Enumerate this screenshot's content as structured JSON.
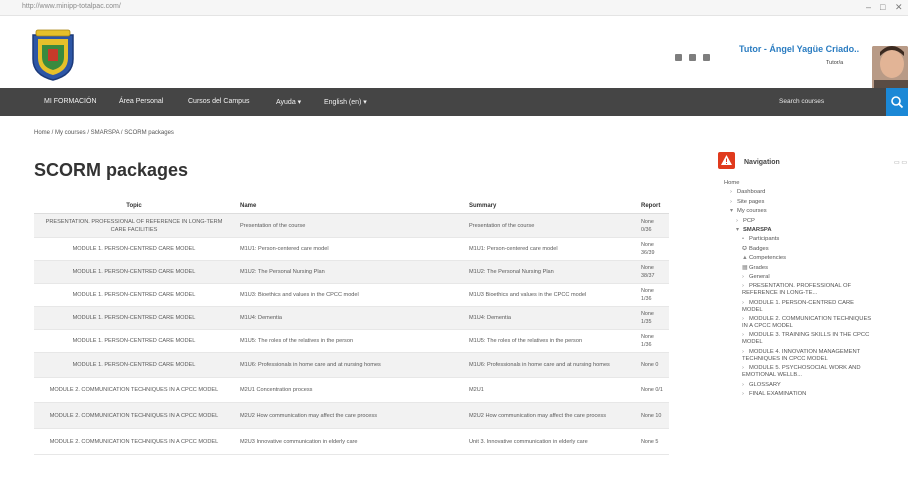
{
  "browser": {
    "url": "http://www.minipp-totalpac.com/",
    "controls": [
      "–",
      "□",
      "✕"
    ]
  },
  "header": {
    "crest_icon": "coat-of-arms-icon",
    "icons": [
      "grid-icon",
      "message-icon",
      "bell-icon"
    ],
    "user_name": "Tutor - Ángel Yagüe Criado..",
    "user_role": "Tutor/a"
  },
  "navbar": {
    "items": [
      "MI FORMACIÓN",
      "Área Personal",
      "Cursos del Campus",
      "Ayuda ▾",
      "English (en) ▾"
    ],
    "search_label": "Search courses",
    "search_icon": "search-icon"
  },
  "breadcrumb": "Home / My courses / SMARSPA / SCORM packages",
  "page_title": "SCORM packages",
  "table": {
    "headers": [
      "Topic",
      "Name",
      "Summary",
      "Report"
    ],
    "rows": [
      [
        "PRESENTATION. PROFESSIONAL OF REFERENCE IN LONG-TERM CARE FACILITIES",
        "Presentation of the course",
        "Presentation of the course",
        "None 0/36"
      ],
      [
        "MODULE 1. PERSON-CENTRED CARE MODEL",
        "M1U1: Person-centered care model",
        "M1U1: Person-centered care model",
        "None 36/39"
      ],
      [
        "MODULE 1. PERSON-CENTRED CARE MODEL",
        "M1U2: The Personal Nursing Plan",
        "M1U2: The Personal Nursing Plan",
        "None 38/37"
      ],
      [
        "MODULE 1. PERSON-CENTRED CARE MODEL",
        "M1U3: Bioethics and values in the CPCC model",
        "M1U3 Bioethics and values in the CPCC model",
        "None 1/36"
      ],
      [
        "MODULE 1. PERSON-CENTRED CARE MODEL",
        "M1U4: Dementia",
        "M1U4: Dementia",
        "None 1/35"
      ],
      [
        "MODULE 1. PERSON-CENTRED CARE MODEL",
        "M1U5: The roles of the relatives in the person",
        "M1U5: The roles of the relatives in the person",
        "None 1/36"
      ],
      [
        "MODULE 1. PERSON-CENTRED CARE MODEL",
        "M1U6: Professionals in home care and at nursing homes",
        "M1U6: Professionals in home care and at nursing homes",
        "None 0"
      ],
      [
        "MODULE 2. COMMUNICATION TECHNIQUES IN A CPCC MODEL",
        "M2U1 Concentration process",
        "M2U1",
        "None 0/1"
      ],
      [
        "MODULE 2. COMMUNICATION TECHNIQUES IN A CPCC MODEL",
        "M2U2 How communication may affect the care process",
        "M2U2 How communication may affect the care process",
        "None 10"
      ],
      [
        "MODULE 2. COMMUNICATION TECHNIQUES IN A CPCC MODEL",
        "M2U3 Innovative communication in elderly care",
        "Unit 3. Innovative communication in elderly care",
        "None 5"
      ]
    ]
  },
  "navigation": {
    "title": "Navigation",
    "icon": "warning-icon",
    "collapse_label": "▭ ▭",
    "items": [
      {
        "marker": "",
        "text": "Home",
        "level": 0
      },
      {
        "marker": "›",
        "text": "Dashboard",
        "level": 1
      },
      {
        "marker": "›",
        "text": "Site pages",
        "level": 1
      },
      {
        "marker": "▾",
        "text": "My courses",
        "level": 1
      },
      {
        "marker": "›",
        "text": "PCP",
        "level": 2
      },
      {
        "marker": "▾",
        "text": "SMARSPA",
        "level": 2,
        "bold": true
      },
      {
        "marker": "👥",
        "text": "Participants",
        "level": 3
      },
      {
        "marker": "🏅",
        "text": "Badges",
        "level": 3
      },
      {
        "marker": "📊",
        "text": "Competencies",
        "level": 3
      },
      {
        "marker": "▦",
        "text": "Grades",
        "level": 3
      },
      {
        "marker": "›",
        "text": "General",
        "level": 3
      },
      {
        "marker": "›",
        "text": "PRESENTATION. PROFESSIONAL OF REFERENCE IN LONG-TE...",
        "level": 3
      },
      {
        "marker": "›",
        "text": "MODULE 1. PERSON-CENTRED CARE MODEL",
        "level": 3
      },
      {
        "marker": "›",
        "text": "MODULE 2. COMMUNICATION TECHNIQUES IN A CPCC MODEL",
        "level": 3
      },
      {
        "marker": "›",
        "text": "MODULE 3. TRAINING SKILLS IN THE CPCC MODEL",
        "level": 3
      },
      {
        "marker": "›",
        "text": "MODULE 4. INNOVATION MANAGEMENT TECHNIQUES IN CPCC MODEL",
        "level": 3
      },
      {
        "marker": "›",
        "text": "MODULE 5. PSYCHOSOCIAL WORK AND EMOTIONAL WELLB...",
        "level": 3
      },
      {
        "marker": "›",
        "text": "GLOSSARY",
        "level": 3
      },
      {
        "marker": "›",
        "text": "FINAL EXAMINATION",
        "level": 3
      }
    ]
  },
  "colors": {
    "navbar": "#454545",
    "accent": "#1b88d6",
    "user_link": "#2a7cc1",
    "nav_icon": "#e03a1d"
  }
}
